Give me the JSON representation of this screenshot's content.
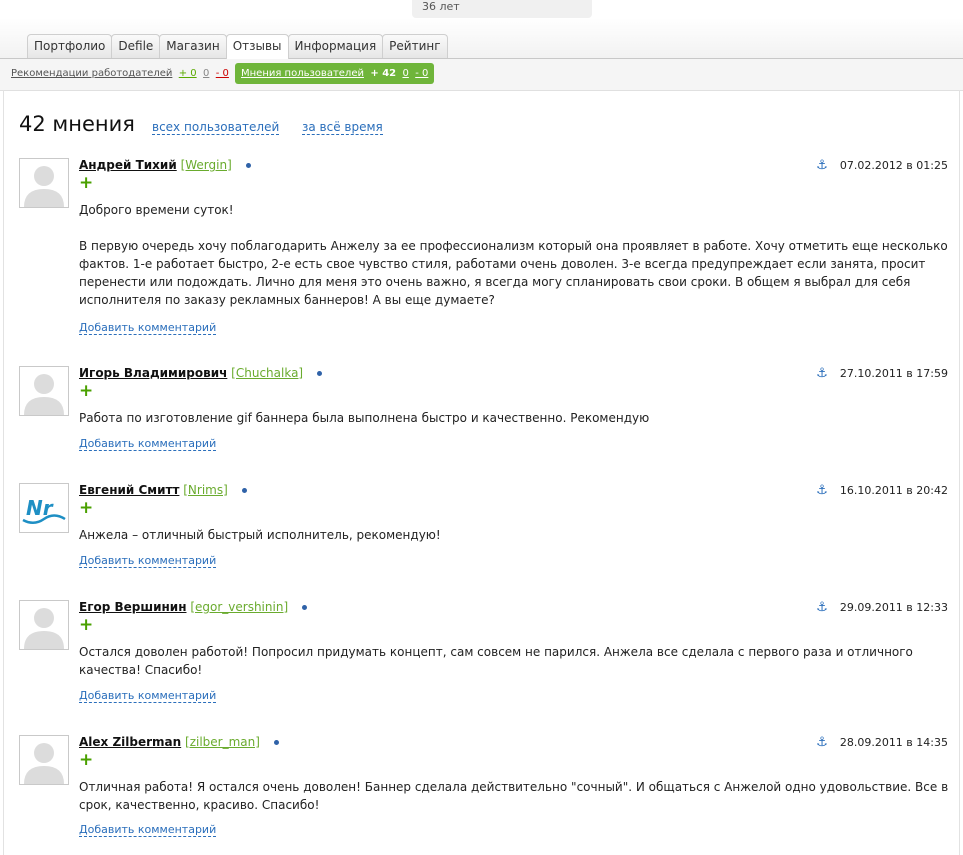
{
  "profile": {
    "age": "36 лет"
  },
  "tabs": [
    "Портфолио",
    "Defile",
    "Магазин",
    "Отзывы",
    "Информация",
    "Рейтинг"
  ],
  "active_tab": "Отзывы",
  "subbar": {
    "employer_label": "Рекомендации работодателей",
    "employer_plus": "+ 0",
    "employer_zero": "0",
    "employer_minus": "- 0",
    "user_label": "Мнения пользователей",
    "user_plus": "+ 42",
    "user_zero": "0",
    "user_minus": "- 0"
  },
  "summary": {
    "count": "42 мнения",
    "filter_users": "всех пользователей",
    "filter_time": "за всё время"
  },
  "add_comment_label": "Добавить комментарий",
  "plus_sign": "+",
  "reviews": [
    {
      "name": "Андрей Тихий",
      "login": "[Wergin]",
      "date": "07.02.2012 в 01:25",
      "paragraphs": [
        "Доброго времени суток!",
        "В первую очередь хочу поблагодарить Анжелу за ее профессионализм который она проявляет в работе. Хочу отметить еще несколько фактов. 1-е работает быстро, 2-е есть свое чувство стиля, работами очень доволен. 3-е всегда предупреждает если занята, просит перенести или подождать. Лично для меня это очень важно, я всегда могу спланировать свои сроки. В общем я выбрал для себя исполнителя по заказу рекламных баннеров! А вы еще думаете?"
      ]
    },
    {
      "name": "Игорь Владимирович",
      "login": "[Chuchalka]",
      "date": "27.10.2011 в 17:59",
      "paragraphs": [
        "Работа по изготовление gif баннера была выполнена быстро и качественно. Рекомендую"
      ]
    },
    {
      "name": "Евгений Смитт",
      "login": "[Nrims]",
      "date": "16.10.2011 в 20:42",
      "avatar_text": "Nr",
      "paragraphs": [
        "Анжела – отличный быстрый исполнитель, рекомендую!"
      ]
    },
    {
      "name": "Егор Вершинин",
      "login": "[egor_vershinin]",
      "date": "29.09.2011 в 12:33",
      "paragraphs": [
        "Остался доволен работой! Попросил придумать концепт, сам совсем не парился. Анжела все сделала с первого раза и отличного качества! Спасибо!"
      ]
    },
    {
      "name": "Alex Zilberman",
      "login": "[zilber_man]",
      "date": "28.09.2011 в 14:35",
      "paragraphs": [
        "Отличная работа! Я остался очень доволен! Баннер сделала действительно \"сочный\". И общаться с Анжелой одно удовольствие. Все в срок, качественно, красиво. Спасибо!"
      ]
    }
  ]
}
